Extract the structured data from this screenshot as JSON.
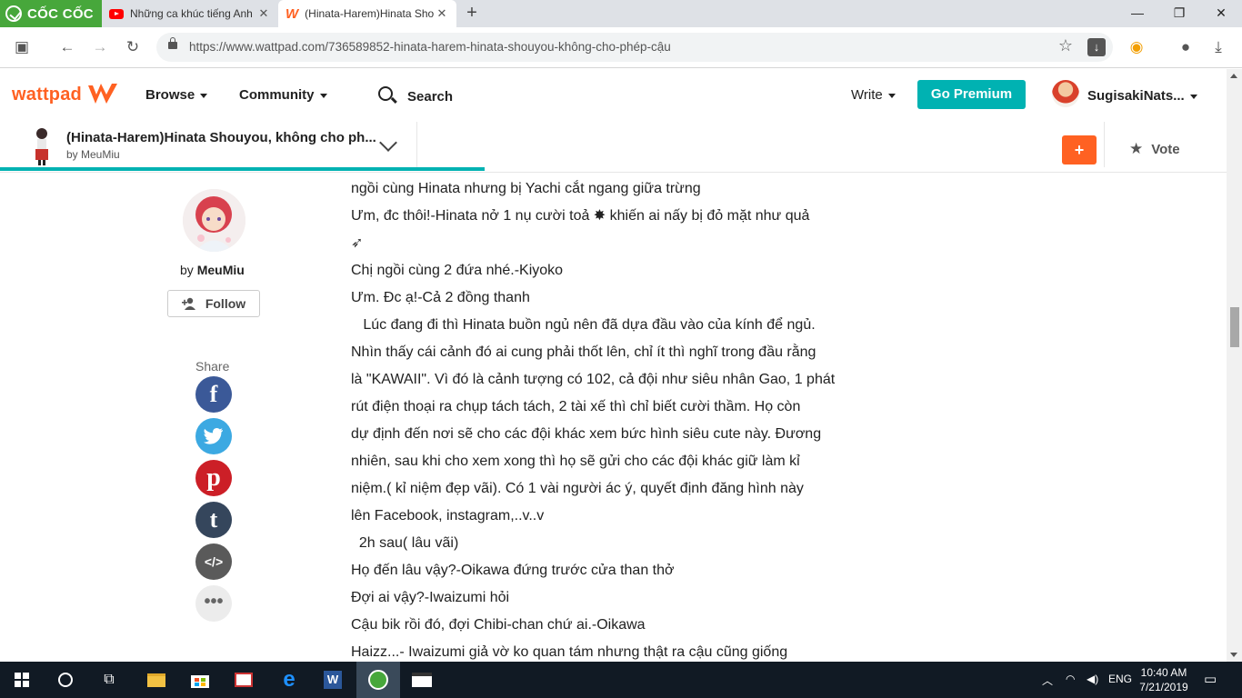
{
  "browser": {
    "brand": "CỐC CỐC",
    "tabs": [
      {
        "title": "Những ca khúc tiếng Anh",
        "icon": "youtube-icon"
      },
      {
        "title": "(Hinata-Harem)Hinata Sho",
        "icon": "wattpad-icon"
      }
    ],
    "url": "https://www.wattpad.com/736589852-hinata-harem-hinata-shouyou-không-cho-phép-cậu"
  },
  "wattpad": {
    "logo": "wattpad",
    "nav": {
      "browse": "Browse",
      "community": "Community",
      "search": "Search",
      "write": "Write"
    },
    "premium": "Go Premium",
    "username": "SugisakiNats..."
  },
  "story": {
    "title": "(Hinata-Harem)Hinata Shouyou, không cho ph...",
    "by": "by MeuMiu",
    "add": "+",
    "vote": "Vote",
    "reading_progress": 0.39
  },
  "author": {
    "by_prefix": "by",
    "name": "MeuMiu",
    "follow": "Follow",
    "share_label": "Share",
    "share": [
      "facebook",
      "twitter",
      "pinterest",
      "tumblr",
      "embed",
      "more"
    ]
  },
  "paragraphs": [
    "ngồi cùng Hinata nhưng bị Yachi cắt ngang giữa trừng",
    "Ưm, đc thôi!-Hinata nở 1 nụ cười toả ✸ khiến ai nấy bị đỏ mặt như quả",
    "",
    "Chị ngồi cùng 2 đứa nhé.-Kiyoko",
    "Ưm. Đc ạ!-Cả 2 đồng thanh",
    "   Lúc đang đi thì Hinata buồn ngủ nên đã dựa đầu vào của kính để ngủ.",
    "Nhìn thấy cái cảnh đó ai cung phải thốt lên, chỉ ít thì nghĩ trong đầu rằng",
    "là \"KAWAII\". Vì đó là cảnh tượng có 102, cả đội như siêu nhân Gao, 1 phát",
    "rút điện thoại ra chụp tách tách, 2 tài xế thì chỉ biết cười thầm. Họ còn",
    "dự định đến nơi sẽ cho các đội khác xem bức hình siêu cute này. Đương",
    "nhiên, sau khi cho xem xong thì họ sẽ gửi cho các đội khác giữ làm kỉ",
    "niệm.( kỉ niệm đẹp vãi). Có 1 vài người ác ý, quyết định đăng hình này",
    "lên Facebook, instagram,..v..v",
    "  2h sau( lâu vãi)",
    "Họ đến lâu vậy?-Oikawa đứng trước cửa than thở",
    "Đợi ai vậy?-Iwaizumi hỏi",
    "Cậu bik rồi đó, đợi Chibi-chan chứ ai.-Oikawa",
    "Haizz...- Iwaizumi giả vờ ko quan tám nhưng thật ra cậu cũng giống"
  ],
  "taskbar": {
    "lang": "ENG",
    "time": "10:40 AM",
    "date": "7/21/2019"
  },
  "colors": {
    "wattpad_orange": "#ff6122",
    "teal": "#00b2b2",
    "coccoc_green": "#47a73b",
    "taskbar": "#111a24"
  }
}
